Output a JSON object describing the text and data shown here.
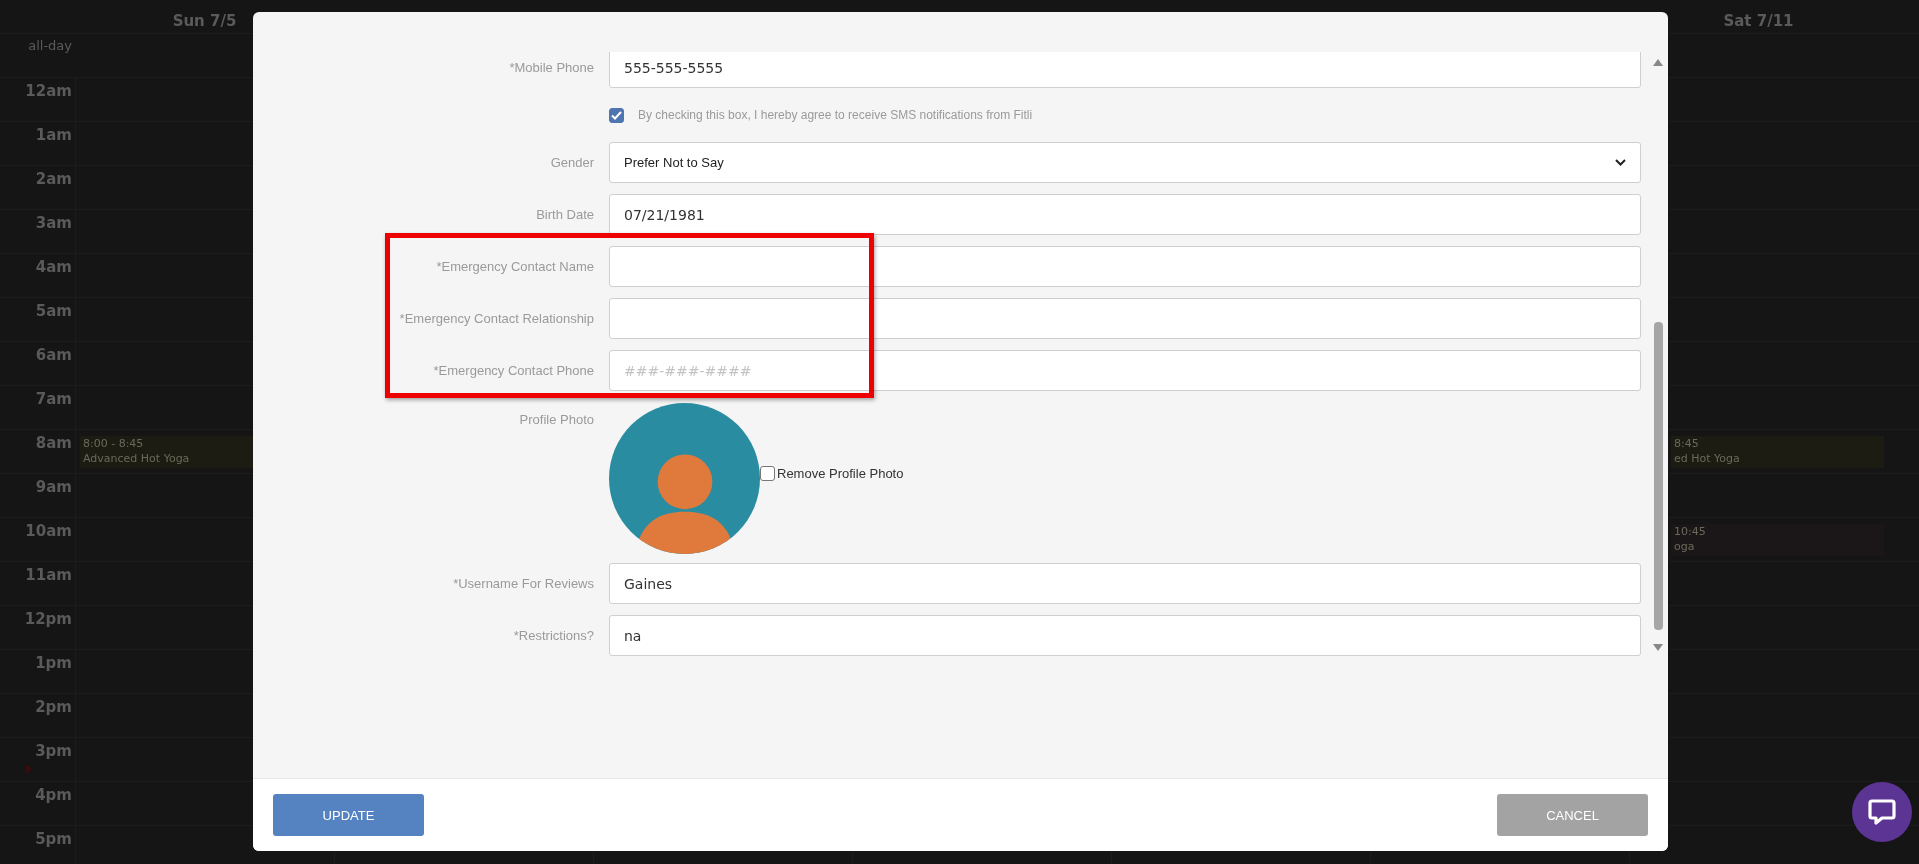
{
  "calendar": {
    "first_day": "Sun 7/5",
    "last_day": "Sat 7/11",
    "all_day_label": "all-day",
    "hours": [
      {
        "label": "12am"
      },
      {
        "label": "1am"
      },
      {
        "label": "2am"
      },
      {
        "label": "3am"
      },
      {
        "label": "4am"
      },
      {
        "label": "5am"
      },
      {
        "label": "6am"
      },
      {
        "label": "7am"
      },
      {
        "label": "8am",
        "first_day_event": {
          "time": "8:00 - 8:45",
          "title": "Advanced Hot Yoga",
          "color": "#1d1c12"
        },
        "last_day_event": {
          "time": "8:45",
          "title": "ed Hot Yoga",
          "color": "#1d1c12"
        }
      },
      {
        "label": "9am"
      },
      {
        "label": "10am",
        "last_day_event": {
          "time": "10:45",
          "title": "oga",
          "color": "#1b1718"
        }
      },
      {
        "label": "11am"
      },
      {
        "label": "12pm"
      },
      {
        "label": "1pm"
      },
      {
        "label": "2pm"
      },
      {
        "label": "3pm"
      },
      {
        "label": "4pm"
      },
      {
        "label": "5pm"
      }
    ]
  },
  "modal": {
    "fields": [
      {
        "kind": "input",
        "label": "*Mobile Phone",
        "value": "555-555-5555"
      },
      {
        "kind": "checkbox",
        "text": "By checking this box, I hereby agree to receive SMS notifications from Fitli",
        "checked": true
      },
      {
        "kind": "select",
        "label": "Gender",
        "value": "Prefer Not to Say"
      },
      {
        "kind": "input",
        "label": "Birth Date",
        "value": "07/21/1981"
      },
      {
        "kind": "group",
        "highlighted": true,
        "fields": [
          {
            "kind": "input",
            "label": "*Emergency Contact Name"
          },
          {
            "kind": "input",
            "label": "*Emergency Contact Relationship"
          },
          {
            "kind": "input",
            "label": "*Emergency Contact Phone",
            "placeholder": "###-###-####"
          }
        ]
      },
      {
        "kind": "photo",
        "label": "Profile Photo",
        "remove_label": "Remove Profile Photo",
        "remove_checked": false
      },
      {
        "kind": "input",
        "label": "*Username For Reviews",
        "value": "Gaines"
      },
      {
        "kind": "input",
        "label": "*Restrictions?",
        "value": "na"
      }
    ],
    "buttons": {
      "update": "UPDATE",
      "cancel": "CANCEL"
    }
  }
}
